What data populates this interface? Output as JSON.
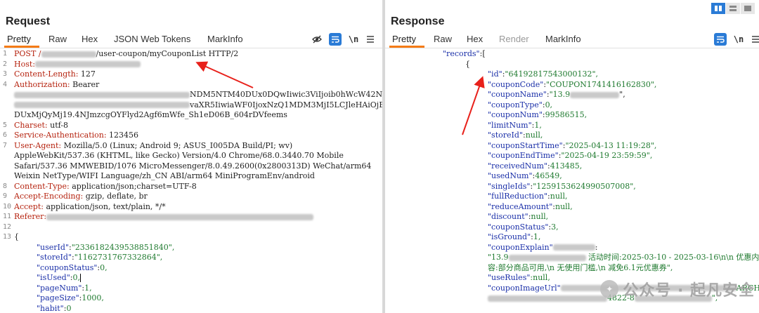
{
  "request": {
    "title": "Request",
    "tabs": [
      "Pretty",
      "Raw",
      "Hex",
      "JSON Web Tokens",
      "MarkInfo"
    ],
    "icons": [
      "eye-off-icon",
      "wrap-icon",
      "newline-icon",
      "menu-icon"
    ],
    "newline_label": "\\n",
    "lines": [
      {
        "n": "1",
        "k": "POST /",
        "v": "/user-coupon/myCouponList HTTP/2"
      },
      {
        "n": "2",
        "k": "Host:",
        "v": ""
      },
      {
        "n": "3",
        "k": "Content-Length:",
        "v": " 127"
      },
      {
        "n": "4",
        "k": "Authorization:",
        "v": " Bearer"
      },
      {
        "n": "",
        "k": "",
        "v": "NDM5NTM40DUx0DQwIiwic3ViIjoib0hWcW42NU15S1"
      },
      {
        "n": "",
        "k": "",
        "v": "vaXR5IiwiaWF0IjoxNzQ1MDM3MjI5LCJleHAiOjE3N"
      },
      {
        "n": "",
        "k": "",
        "v": "DUxMjQyMj19.4NJmzcgOYFlyd2Agf6mWfe_Sh1eD06B_604rDVfeems"
      },
      {
        "n": "5",
        "k": "Charset:",
        "v": " utf-8"
      },
      {
        "n": "6",
        "k": "Service-Authentication:",
        "v": " 123456"
      },
      {
        "n": "7",
        "k": "User-Agent:",
        "v": " Mozilla/5.0 (Linux; Android 9; ASUS_I005DA Build/PI; wv)"
      },
      {
        "n": "",
        "k": "",
        "v": "AppleWebKit/537.36 (KHTML, like Gecko) Version/4.0 Chrome/68.0.3440.70 Mobile"
      },
      {
        "n": "",
        "k": "",
        "v": "Safari/537.36 MMWEBID/1076 MicroMessenger/8.0.49.2600(0x2800313D) WeChat/arm64"
      },
      {
        "n": "",
        "k": "",
        "v": "Weixin NetType/WIFI Language/zh_CN ABI/arm64 MiniProgramEnv/android"
      },
      {
        "n": "8",
        "k": "Content-Type:",
        "v": " application/json;charset=UTF-8"
      },
      {
        "n": "9",
        "k": "Accept-Encoding:",
        "v": " gzip, deflate, br"
      },
      {
        "n": "10",
        "k": "Accept:",
        "v": " application/json, text/plain, */*"
      },
      {
        "n": "11",
        "k": "Referer:",
        "v": ""
      },
      {
        "n": "12",
        "k": "",
        "v": ""
      },
      {
        "n": "13",
        "k": "",
        "v": "{"
      }
    ],
    "body": [
      {
        "key": "\"userId\"",
        "val": "\"2336182439538851840\","
      },
      {
        "key": "\"storeId\"",
        "val": "\"1162731767332864\","
      },
      {
        "key": "\"couponStatus\"",
        "val": "0,"
      },
      {
        "key": "\"isUsed\"",
        "val": "0,"
      },
      {
        "key": "\"pageNum\"",
        "val": "1,"
      },
      {
        "key": "\"pageSize\"",
        "val": "1000,"
      },
      {
        "key": "\"habit\"",
        "val": "0"
      }
    ]
  },
  "response": {
    "title": "Response",
    "tabs": [
      "Pretty",
      "Raw",
      "Hex",
      "Render",
      "MarkInfo"
    ],
    "icons": [
      "wrap-icon",
      "newline-icon",
      "menu-icon"
    ],
    "newline_label": "\\n",
    "records_key": "\"records\"",
    "records_open": ":[",
    "obj_open": "{",
    "fields": [
      {
        "key": "\"id\"",
        "val": "\"64192817543000132\","
      },
      {
        "key": "\"couponCode\"",
        "val": "\"COUPON1741416162830\","
      },
      {
        "key": "\"couponName\"",
        "val": "\"13.9"
      },
      {
        "key": "\"couponType\"",
        "val": "0,"
      },
      {
        "key": "\"couponNum\"",
        "val": "99586515,"
      },
      {
        "key": "\"limitNum\"",
        "val": "1,"
      },
      {
        "key": "\"storeId\"",
        "val": "null,"
      },
      {
        "key": "\"couponStartTime\"",
        "val": "\"2025-04-13 11:19:28\","
      },
      {
        "key": "\"couponEndTime\"",
        "val": "\"2025-04-19 23:59:59\","
      },
      {
        "key": "\"receivedNum\"",
        "val": "413485,"
      },
      {
        "key": "\"usedNum\"",
        "val": "46549,"
      },
      {
        "key": "\"singleIds\"",
        "val": "\"1259153624990507008\","
      },
      {
        "key": "\"fullReduction\"",
        "val": "null,"
      },
      {
        "key": "\"reduceAmount\"",
        "val": "null,"
      },
      {
        "key": "\"discount\"",
        "val": "null,"
      },
      {
        "key": "\"couponStatus\"",
        "val": "3,"
      },
      {
        "key": "\"isGround\"",
        "val": "1,"
      },
      {
        "key": "\"couponExplain\"",
        "val": ":"
      }
    ],
    "explain_line1_start": "\"13.9",
    "explain_line1_rest": "活动时间:2025-03-10 - 2025-03-16\\n\\n 优惠内",
    "explain_line2": "容:部分商品可用,\\n 无使用门槛,\\n 减免6.1元优惠券\",",
    "use_rules_key": "\"useRules\"",
    "use_rules_val": ":null,",
    "image_key": "\"couponImageUrl\"",
    "image_tail": "ARCH/",
    "image_line2_mid": "4822-8",
    "image_line2_end": "\","
  },
  "watermark": "公众号 · 起凡安全"
}
